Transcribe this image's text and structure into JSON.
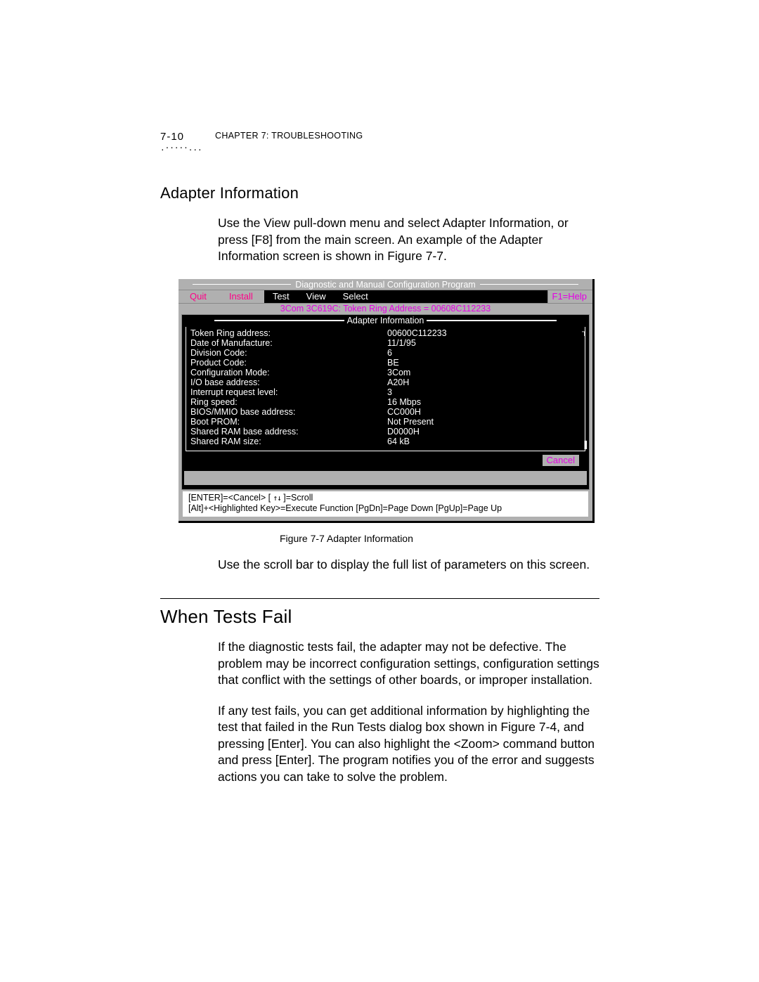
{
  "header": {
    "page_number": "7-10",
    "chapter_label": "CHAPTER 7: TROUBLESHOOTING"
  },
  "section1": {
    "title": "Adapter Information",
    "para1": "Use the View pull-down menu and select Adapter Information, or press [F8] from the main screen. An example of the Adapter Information screen is shown in Figure 7-7.",
    "caption": "Figure 7-7   Adapter Information",
    "para2": "Use the scroll bar to display the full list of parameters on this screen."
  },
  "dos": {
    "program_title": "Diagnostic and Manual Configuration Program",
    "menus": {
      "quit": "Quit",
      "install": "Install",
      "test": "Test",
      "view": "View",
      "select": "Select",
      "help": "F1=Help"
    },
    "addr_line": "3Com 3C619C: Token Ring Address = 00608C112233",
    "inner_title": "Adapter Information",
    "params": [
      {
        "k": "Token Ring address:",
        "v": "00600C112233"
      },
      {
        "k": "Date of Manufacture:",
        "v": "11/1/95"
      },
      {
        "k": "Division Code:",
        "v": "6"
      },
      {
        "k": "Product Code:",
        "v": "BE"
      },
      {
        "k": "Configuration Mode:",
        "v": "3Com"
      },
      {
        "k": "I/O base address:",
        "v": "A20H"
      },
      {
        "k": "Interrupt request level:",
        "v": "3"
      },
      {
        "k": "Ring speed:",
        "v": "16 Mbps"
      },
      {
        "k": "BIOS/MMIO base address:",
        "v": "CC000H"
      },
      {
        "k": "Boot PROM:",
        "v": "Not Present"
      },
      {
        "k": "Shared RAM base address:",
        "v": "D0000H"
      },
      {
        "k": "Shared RAM size:",
        "v": "64 kB"
      }
    ],
    "cancel_label": "Cancel",
    "footer1_a": "[ENTER]=<Cancel>  [ ",
    "footer1_b": " ]=Scroll",
    "footer2": "[Alt]+<Highlighted Key>=Execute Function  [PgDn]=Page Down  [PgUp]=Page Up"
  },
  "section2": {
    "title": "When Tests Fail",
    "para1": "If the diagnostic tests fail, the adapter may not be defective. The problem may be incorrect configuration settings, configuration settings that conflict with the settings of other boards, or improper installation.",
    "para2": "If any test fails, you can get additional information by highlighting the test that failed in the Run Tests dialog box shown in Figure 7-4, and pressing [Enter]. You can also highlight the <Zoom> command button and press [Enter]. The program notifies you of the error and suggests actions you can take to solve the problem."
  }
}
